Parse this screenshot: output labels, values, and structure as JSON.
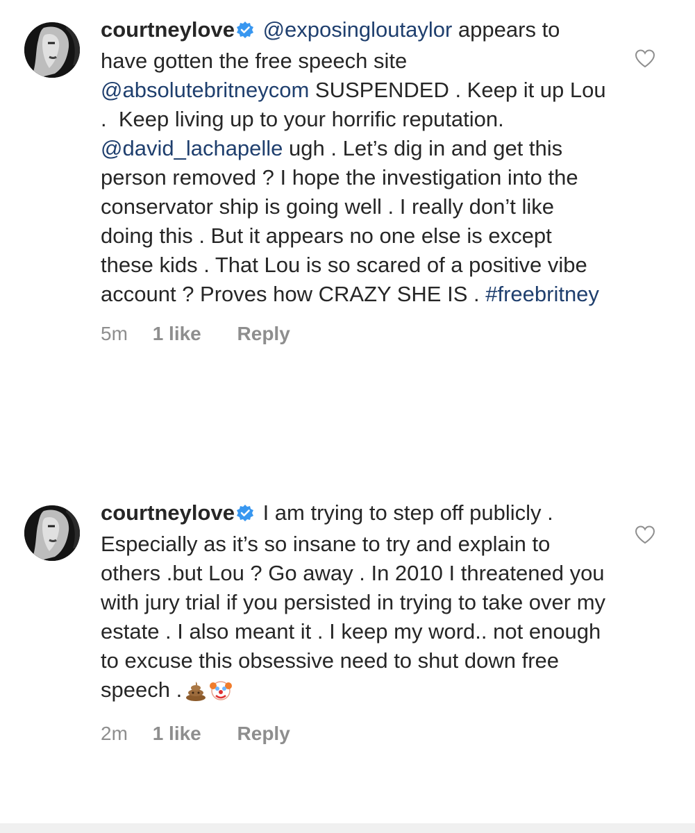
{
  "comments": [
    {
      "username": "courtneylove",
      "segments": [
        {
          "type": "link",
          "text": "@exposingloutaylor"
        },
        {
          "type": "text",
          "text": " appears to have gotten the free speech site "
        },
        {
          "type": "link",
          "text": "@absolutebritneycom"
        },
        {
          "type": "text",
          "text": " SUSPENDED . Keep it up Lou .  Keep living up to your horrific reputation. "
        },
        {
          "type": "link",
          "text": "@david_lachapelle"
        },
        {
          "type": "text",
          "text": " ugh . Let’s dig in and get this person removed ? I hope the investigation into the conservator ship is going well . I really don’t like doing this . But it appears no one else is except these kids . That Lou is so scared of a positive vibe account ? Proves how CRAZY SHE IS . "
        },
        {
          "type": "link",
          "text": "#freebritney"
        }
      ],
      "time": "5m",
      "likes": "1 like",
      "reply": "Reply"
    },
    {
      "username": "courtneylove",
      "segments": [
        {
          "type": "text",
          "text": "I am trying to step off publicly . Especially as it’s so insane to try and explain to others .but Lou ? Go away . In 2010 I threatened you with jury trial if you persisted in trying to take over my estate . I also meant it . I keep my word.. not enough to excuse this obsessive need to shut down free speech ."
        }
      ],
      "emojis": [
        "poo-emoji",
        "clown-emoji"
      ],
      "time": "2m",
      "likes": "1 like",
      "reply": "Reply"
    }
  ],
  "colors": {
    "text": "#262626",
    "link": "#1f3f6e",
    "meta": "#8e8e8e",
    "verified": "#3897f0"
  },
  "icons": [
    "avatar",
    "verified-badge-icon",
    "heart-icon",
    "poo-emoji",
    "clown-emoji"
  ]
}
